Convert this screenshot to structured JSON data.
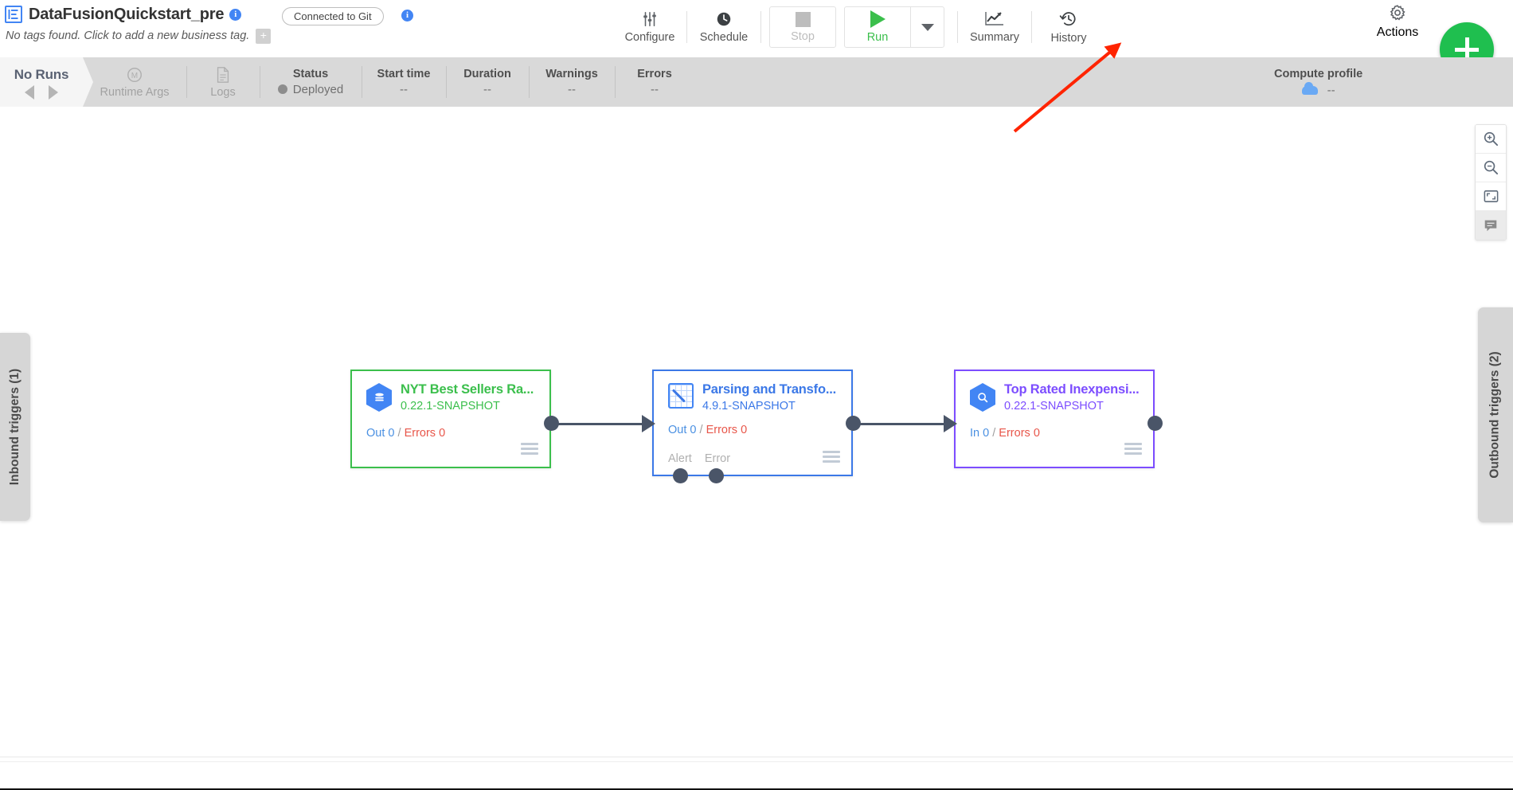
{
  "header": {
    "logo_icon": "datafusion-logo-icon",
    "pipeline_name": "DataFusionQuickstart_pre",
    "name_info_icon": "info-icon",
    "tags_text": "No tags found. Click to add a new business tag.",
    "tag_add_label": "+",
    "git_status": "Connected to Git",
    "git_info_icon": "info-icon"
  },
  "toolbar": {
    "configure": {
      "label": "Configure",
      "icon": "sliders-icon"
    },
    "schedule": {
      "label": "Schedule",
      "icon": "clock-icon"
    },
    "stop": {
      "label": "Stop",
      "icon": "stop-square-icon",
      "enabled": "false"
    },
    "run": {
      "label": "Run",
      "icon": "play-triangle-icon",
      "enabled": "true"
    },
    "run_caret": "chevron-down-icon",
    "summary": {
      "label": "Summary",
      "icon": "line-chart-icon"
    },
    "history": {
      "label": "History",
      "icon": "history-clock-icon"
    },
    "actions": {
      "label": "Actions",
      "icon": "gear-icon"
    },
    "add_button": {
      "label": "+",
      "icon": "plus-icon",
      "color": "#1fbf4f"
    }
  },
  "status_bar": {
    "runs_tab_title": "No Runs",
    "prev_icon": "chevron-left-icon",
    "next_icon": "chevron-right-icon",
    "cells": [
      {
        "name": "runtime-args",
        "header": "Runtime Args",
        "value": "",
        "icon": "macro-icon",
        "muted": "true"
      },
      {
        "name": "logs",
        "header": "Logs",
        "value": "",
        "icon": "document-icon",
        "muted": "true"
      },
      {
        "name": "status",
        "header": "Status",
        "value": "Deployed",
        "icon": "status-dot-icon",
        "muted": "false"
      },
      {
        "name": "start-time",
        "header": "Start time",
        "value": "--",
        "muted": "false"
      },
      {
        "name": "duration",
        "header": "Duration",
        "value": "--",
        "muted": "false"
      },
      {
        "name": "warnings",
        "header": "Warnings",
        "value": "--",
        "muted": "false"
      },
      {
        "name": "errors",
        "header": "Errors",
        "value": "--",
        "muted": "false"
      }
    ],
    "compute_profile": {
      "header": "Compute profile",
      "value": "--",
      "icon": "cloud-icon"
    }
  },
  "canvas": {
    "inbound_panel": "Inbound triggers (1)",
    "outbound_panel": "Outbound triggers (2)",
    "zoom_controls": [
      {
        "name": "zoom-in",
        "icon": "zoom-in-icon"
      },
      {
        "name": "zoom-out",
        "icon": "zoom-out-icon"
      },
      {
        "name": "fit-to-screen",
        "icon": "fit-screen-icon"
      },
      {
        "name": "comments",
        "icon": "comment-icon"
      }
    ],
    "nodes": [
      {
        "id": "source",
        "title": "NYT Best Sellers Ra...",
        "version": "0.22.1-SNAPSHOT",
        "icon": "database-hexagon-icon",
        "metric_in_label": "Out",
        "metric_in_value": "0",
        "metric_sep": "/",
        "metric_err_label": "Errors",
        "metric_err_value": "0",
        "accent": "#3bbf4c"
      },
      {
        "id": "transform",
        "title": "Parsing and Transfo...",
        "version": "4.9.1-SNAPSHOT",
        "icon": "wrangler-grid-icon",
        "metric_in_label": "Out",
        "metric_in_value": "0",
        "metric_sep": "/",
        "metric_err_label": "Errors",
        "metric_err_value": "0",
        "port_alert": "Alert",
        "port_error": "Error",
        "accent": "#3b78e7"
      },
      {
        "id": "sink",
        "title": "Top Rated Inexpensi...",
        "version": "0.22.1-SNAPSHOT",
        "icon": "bigquery-hexagon-icon",
        "metric_in_label": "In",
        "metric_in_value": "0",
        "metric_sep": "/",
        "metric_err_label": "Errors",
        "metric_err_value": "0",
        "accent": "#7c4dff"
      }
    ],
    "annotation": {
      "type": "arrow",
      "color": "#ff2400",
      "points_to": "history-button"
    }
  }
}
